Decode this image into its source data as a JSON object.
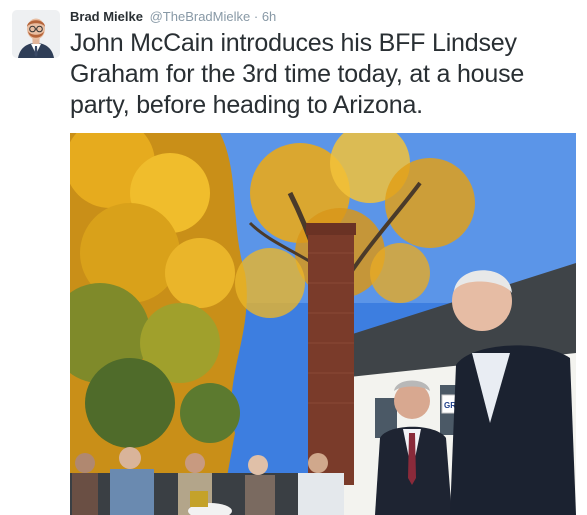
{
  "tweet": {
    "author_name": "Brad Mielke",
    "author_handle": "@TheBradMielke",
    "separator": "·",
    "timestamp": "6h",
    "text": "John McCain introduces his BFF Lindsey Graham for the 3rd time today, at a house party, before heading to Arizona."
  },
  "photo": {
    "sign_text": "GRAH"
  },
  "colors": {
    "name": "#292f33",
    "meta": "#8899a6",
    "sky": "#3d7ee0",
    "foliage": "#e8a81c"
  }
}
